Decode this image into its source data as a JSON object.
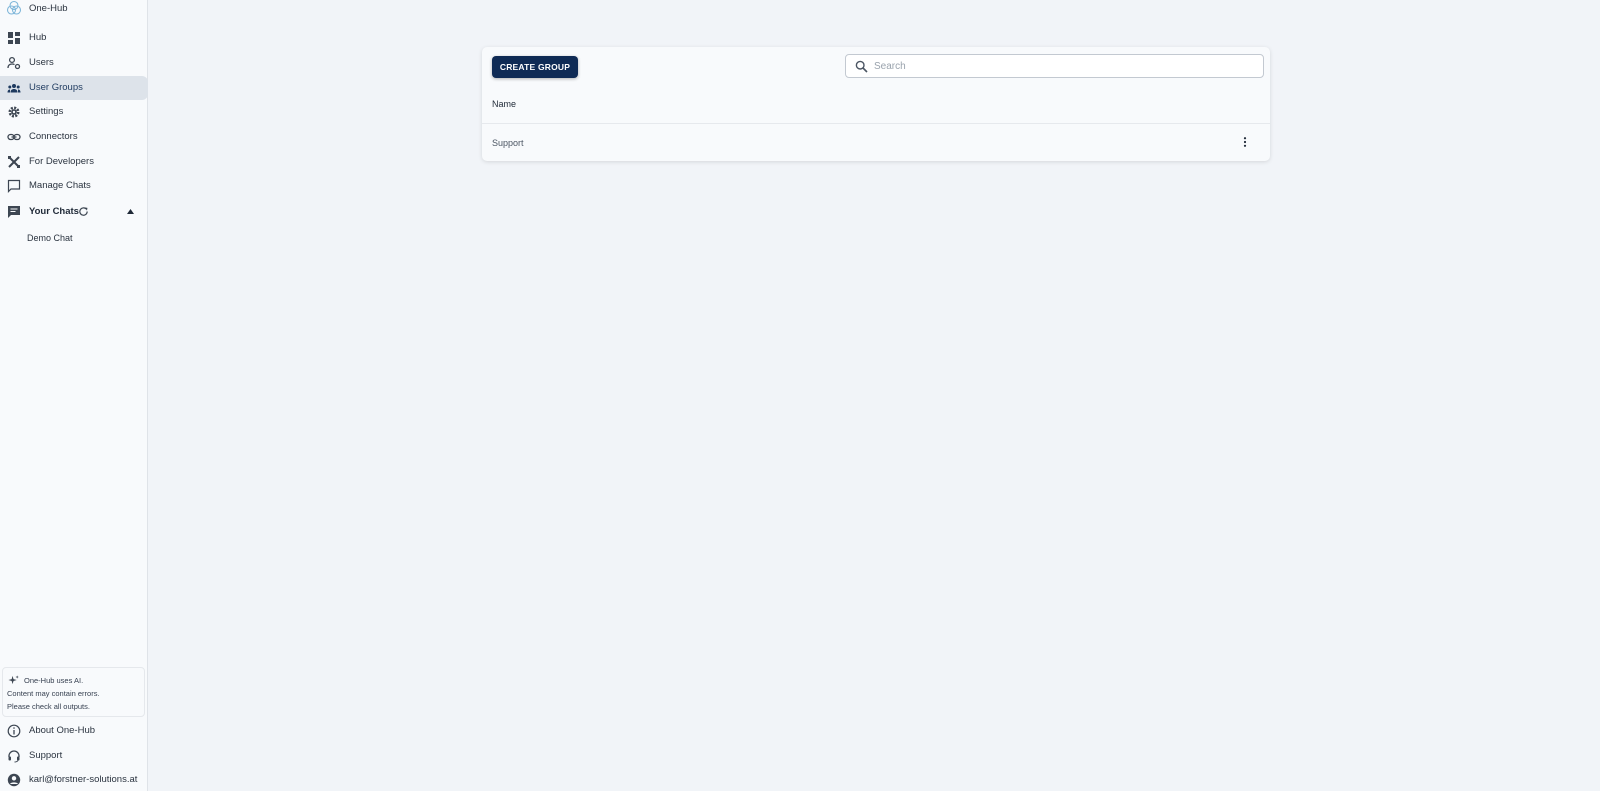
{
  "brand": {
    "name": "One-Hub",
    "icon": "one-hub-logo-icon"
  },
  "nav": {
    "items": [
      {
        "label": "Hub",
        "icon": "dashboard-icon"
      },
      {
        "label": "Users",
        "icon": "user-settings-icon"
      },
      {
        "label": "User Groups",
        "icon": "groups-icon",
        "active": true
      },
      {
        "label": "Settings",
        "icon": "gear-icon"
      },
      {
        "label": "Connectors",
        "icon": "link-icon"
      },
      {
        "label": "For Developers",
        "icon": "developer-tools-icon"
      },
      {
        "label": "Manage Chats",
        "icon": "chat-bubble-icon"
      }
    ],
    "your_chats": {
      "label": "Your Chats",
      "icon": "chat-icon"
    },
    "chats": [
      "Demo Chat"
    ],
    "footer": [
      {
        "label": "About One-Hub",
        "icon": "info-icon"
      },
      {
        "label": "Support",
        "icon": "headset-icon"
      },
      {
        "label": "karl@forstner-solutions.at",
        "icon": "account-icon"
      }
    ]
  },
  "ai_notice": {
    "line1": "One-Hub uses AI.",
    "line2": "Content may contain errors.",
    "line3": "Please check all outputs."
  },
  "toolbar": {
    "create_label": "CREATE GROUP",
    "search_placeholder": "Search",
    "search_value": ""
  },
  "table": {
    "columns": [
      "Name"
    ],
    "rows": [
      {
        "name": "Support"
      }
    ]
  },
  "colors": {
    "primary": "#0f2b55",
    "active_nav_bg": "#dde3ea",
    "page_bg": "#f1f4f8",
    "sidebar_bg": "#f8fafc"
  }
}
